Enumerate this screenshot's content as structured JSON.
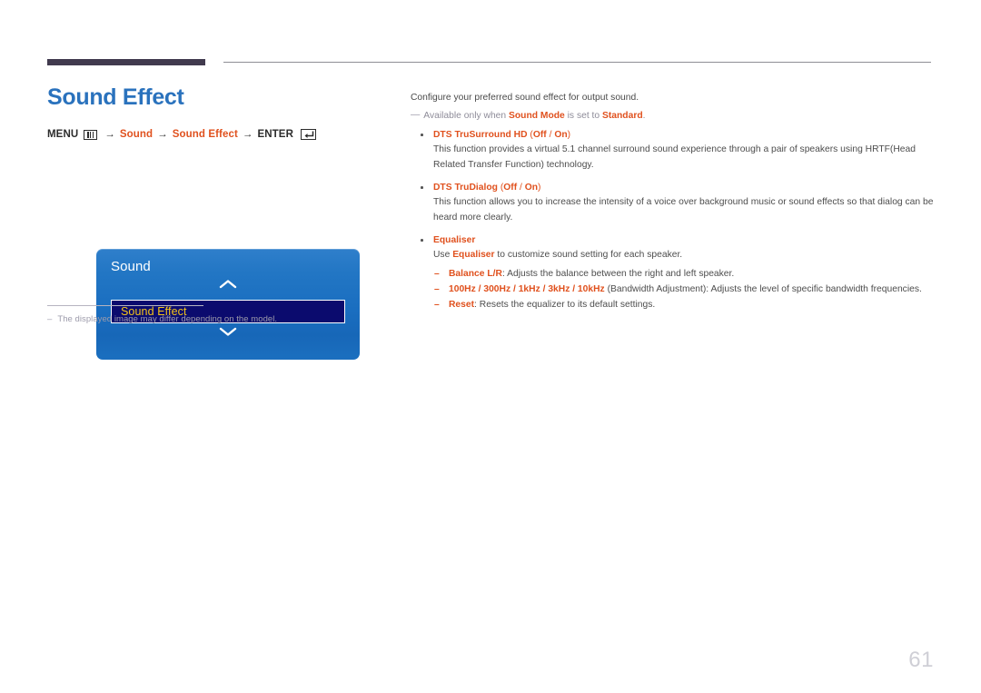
{
  "header": {
    "accent_color": "#413a4e",
    "rule_color": "#8e8e95"
  },
  "left": {
    "page_title": "Sound Effect",
    "breadcrumb": {
      "menu_label": "MENU",
      "menu_icon": "menu-grid-icon",
      "arrow": "→",
      "item1": "Sound",
      "item2": "Sound Effect",
      "enter_label": "ENTER",
      "enter_icon": "enter-key-icon"
    },
    "osd": {
      "title": "Sound",
      "chevron_up": "chevron-up-icon",
      "chevron_down": "chevron-down-icon",
      "selected_item": "Sound Effect",
      "bg_color": "#1a6ec0",
      "highlight_color": "#0b0b6e",
      "highlight_text_color": "#f5c518"
    },
    "note": {
      "dash": "–",
      "text": "The displayed image may differ depending on the model."
    }
  },
  "right": {
    "lead": "Configure your preferred sound effect for output sound.",
    "availability": {
      "dash": "—",
      "pre": "Available only when ",
      "term1": "Sound Mode",
      "mid": " is set to ",
      "term2": "Standard",
      "post": "."
    },
    "bullets": [
      {
        "title": "DTS TruSurround HD",
        "options_open": "(",
        "option_a": "Off",
        "option_sep": " / ",
        "option_b": "On",
        "options_close": ")",
        "body": "This function provides a virtual 5.1 channel surround sound experience through a pair of speakers using HRTF(Head Related Transfer Function) technology."
      },
      {
        "title": "DTS TruDialog",
        "options_open": "(",
        "option_a": "Off",
        "option_sep": " / ",
        "option_b": "On",
        "options_close": ")",
        "body": "This function allows you to increase the intensity of a voice over background music or sound effects so that dialog can be heard more clearly."
      }
    ],
    "equaliser": {
      "title": "Equaliser",
      "body_pre": "Use ",
      "body_term": "Equaliser",
      "body_post": " to customize sound setting for each speaker.",
      "subs": [
        {
          "term": "Balance L/R",
          "text": ": Adjusts the balance between the right and left speaker."
        },
        {
          "term": "100Hz / 300Hz / 1kHz / 3kHz / 10kHz",
          "text": " (Bandwidth Adjustment): Adjusts the level of specific bandwidth frequencies."
        },
        {
          "term": "Reset",
          "text": ": Resets the equalizer to its default settings."
        }
      ]
    }
  },
  "footer": {
    "page_number": "61"
  },
  "colors": {
    "accent_orange": "#e0511e",
    "title_blue": "#2a72bd",
    "header_purple": "#413a4e",
    "page_number_gray": "#cfcfd6"
  }
}
